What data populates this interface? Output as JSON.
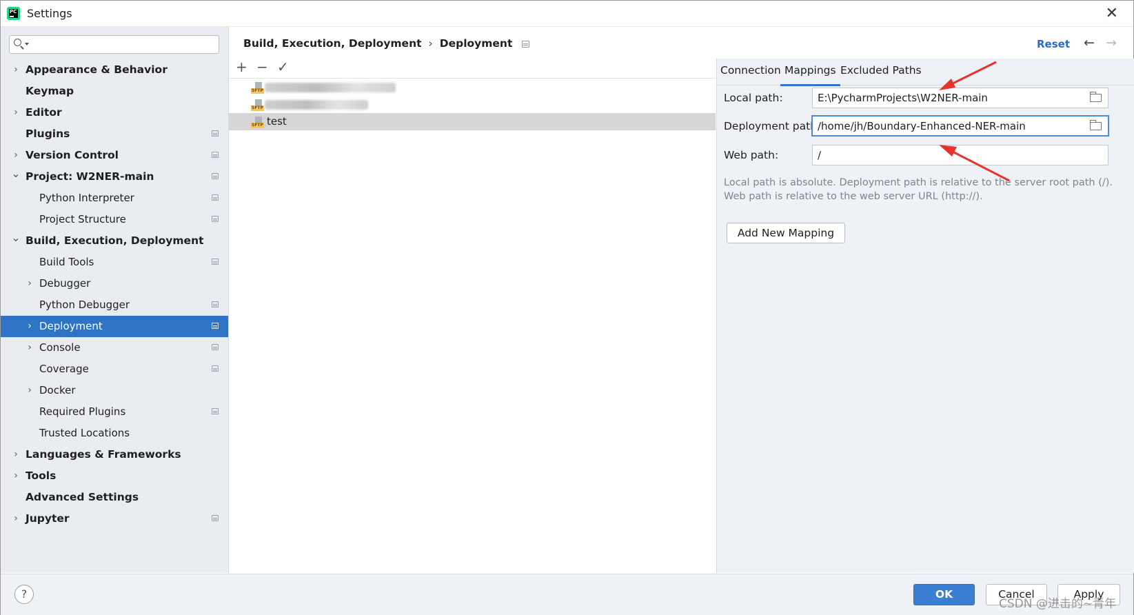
{
  "window": {
    "title": "Settings",
    "app_icon": "pycharm-icon",
    "app_icon_text": "PC"
  },
  "search": {
    "placeholder": "",
    "value": ""
  },
  "sidebar": {
    "items": [
      {
        "label": "Appearance & Behavior",
        "level": 0,
        "expander": "collapsed",
        "project": false
      },
      {
        "label": "Keymap",
        "level": 0,
        "expander": "none",
        "project": false
      },
      {
        "label": "Editor",
        "level": 0,
        "expander": "collapsed",
        "project": false
      },
      {
        "label": "Plugins",
        "level": 0,
        "expander": "none",
        "project": true
      },
      {
        "label": "Version Control",
        "level": 0,
        "expander": "collapsed",
        "project": true
      },
      {
        "label": "Project: W2NER-main",
        "level": 0,
        "expander": "expanded",
        "project": true
      },
      {
        "label": "Python Interpreter",
        "level": 1,
        "expander": "none",
        "project": true
      },
      {
        "label": "Project Structure",
        "level": 1,
        "expander": "none",
        "project": true
      },
      {
        "label": "Build, Execution, Deployment",
        "level": 0,
        "expander": "expanded",
        "project": false
      },
      {
        "label": "Build Tools",
        "level": 1,
        "expander": "none",
        "project": true
      },
      {
        "label": "Debugger",
        "level": 1,
        "expander": "collapsed",
        "project": false
      },
      {
        "label": "Python Debugger",
        "level": 1,
        "expander": "none",
        "project": true
      },
      {
        "label": "Deployment",
        "level": 1,
        "expander": "collapsed",
        "project": true,
        "selected": true
      },
      {
        "label": "Console",
        "level": 1,
        "expander": "collapsed",
        "project": true
      },
      {
        "label": "Coverage",
        "level": 1,
        "expander": "none",
        "project": true
      },
      {
        "label": "Docker",
        "level": 1,
        "expander": "collapsed",
        "project": false
      },
      {
        "label": "Required Plugins",
        "level": 1,
        "expander": "none",
        "project": true
      },
      {
        "label": "Trusted Locations",
        "level": 1,
        "expander": "none",
        "project": false
      },
      {
        "label": "Languages & Frameworks",
        "level": 0,
        "expander": "collapsed",
        "project": false
      },
      {
        "label": "Tools",
        "level": 0,
        "expander": "collapsed",
        "project": false
      },
      {
        "label": "Advanced Settings",
        "level": 0,
        "expander": "none",
        "project": false
      },
      {
        "label": "Jupyter",
        "level": 0,
        "expander": "collapsed",
        "project": true
      }
    ]
  },
  "breadcrumb": {
    "parent": "Build, Execution, Deployment",
    "separator": "›",
    "current": "Deployment"
  },
  "header": {
    "reset_label": "Reset",
    "back_icon": "arrow-left-icon",
    "forward_icon": "arrow-right-icon"
  },
  "toolbar": {
    "add": "+",
    "remove": "−",
    "apply": "✓"
  },
  "servers": [
    {
      "name": "",
      "type": "SFTP",
      "redacted": true
    },
    {
      "name": "",
      "type": "SFTP",
      "redacted": true
    },
    {
      "name": "test",
      "type": "SFTP",
      "redacted": false,
      "selected": true
    }
  ],
  "tabs": [
    "Connection",
    "Mappings",
    "Excluded Paths"
  ],
  "active_tab": "Mappings",
  "mappings": {
    "local_path_label": "Local path:",
    "local_path": "E:\\PycharmProjects\\W2NER-main",
    "deployment_path_label": "Deployment path:",
    "deployment_path": "/home/jh/Boundary-Enhanced-NER-main",
    "web_path_label": "Web path:",
    "web_path": "/",
    "hint_line1": "Local path is absolute. Deployment path is relative to the server root path (/).",
    "hint_line2": "Web path is relative to the web server URL (http://).",
    "add_mapping_label": "Add New Mapping"
  },
  "buttons": {
    "help": "?",
    "ok": "OK",
    "cancel": "Cancel",
    "apply": "Apply"
  },
  "watermark": "CSDN @进击的~青年",
  "colors": {
    "accent": "#2f74c4",
    "annotation_arrow": "#e8322b",
    "sidebar_bg": "#e9edf2",
    "panel_bg": "#eef1f5"
  }
}
